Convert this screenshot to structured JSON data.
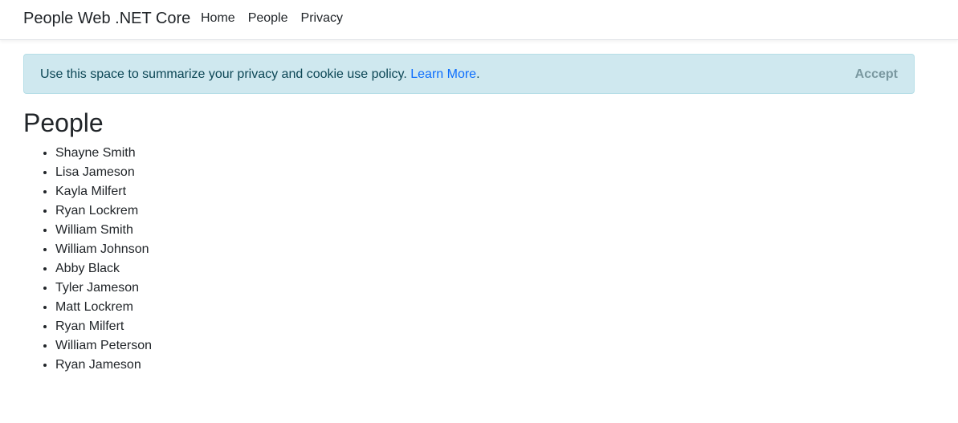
{
  "navbar": {
    "brand": "People Web .NET Core",
    "links": [
      "Home",
      "People",
      "Privacy"
    ]
  },
  "cookie": {
    "message": "Use this space to summarize your privacy and cookie use policy.",
    "learn_more": "Learn More",
    "period": ".",
    "accept": "Accept"
  },
  "main": {
    "title": "People",
    "people": [
      "Shayne Smith",
      "Lisa Jameson",
      "Kayla Milfert",
      "Ryan Lockrem",
      "William Smith",
      "William Johnson",
      "Abby Black",
      "Tyler Jameson",
      "Matt Lockrem",
      "Ryan Milfert",
      "William Peterson",
      "Ryan Jameson"
    ]
  },
  "colors": {
    "alert_background": "#cfe8ef",
    "link": "#0d6efd",
    "text": "#212529"
  }
}
